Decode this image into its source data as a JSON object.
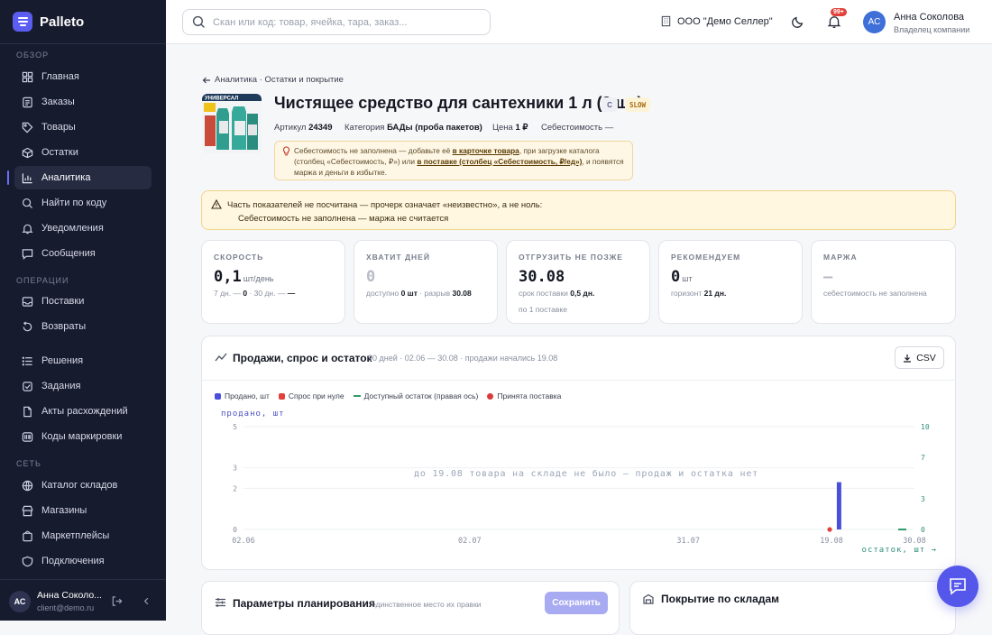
{
  "app": {
    "name": "Palleto"
  },
  "sidebar": {
    "section_overview": "ОБЗОР",
    "section_operations": "ОПЕРАЦИИ",
    "section_network": "СЕТЬ",
    "items": [
      {
        "label": "Главная",
        "icon": "dashboard-icon"
      },
      {
        "label": "Заказы",
        "icon": "orders-icon"
      },
      {
        "label": "Товары",
        "icon": "tag-icon"
      },
      {
        "label": "Остатки",
        "icon": "box-icon"
      },
      {
        "label": "Аналитика",
        "icon": "chart-icon",
        "active": true
      },
      {
        "label": "Найти по коду",
        "icon": "search-icon"
      },
      {
        "label": "Уведомления",
        "icon": "bell-icon"
      },
      {
        "label": "Сообщения",
        "icon": "message-icon"
      },
      {
        "label": "Поставки",
        "icon": "inbox-icon"
      },
      {
        "label": "Возвраты",
        "icon": "return-icon"
      },
      {
        "label": "Решения",
        "icon": "list-icon"
      },
      {
        "label": "Задания",
        "icon": "task-icon"
      },
      {
        "label": "Акты расхождений",
        "icon": "document-icon"
      },
      {
        "label": "Коды маркировки",
        "icon": "barcode-icon"
      },
      {
        "label": "Каталог складов",
        "icon": "warehouse-icon"
      },
      {
        "label": "Магазины",
        "icon": "shop-icon"
      },
      {
        "label": "Маркетплейсы",
        "icon": "cart-icon"
      },
      {
        "label": "Подключения",
        "icon": "plug-icon"
      }
    ],
    "footer": {
      "initials": "АС",
      "name": "Анна Соколо...",
      "email": "client@demo.ru"
    }
  },
  "topbar": {
    "search_placeholder": "Скан или код: товар, ячейка, тара, заказ...",
    "org": "ООО \"Демо Селлер\"",
    "notif_badge": "99+",
    "user_initials": "АС",
    "user_name": "Анна Соколова",
    "user_role": "Владелец компании"
  },
  "breadcrumb": {
    "text": "Аналитика · Остатки и покрытие"
  },
  "product": {
    "title": "Чистящее средство для сантехники 1 л (2 шт)",
    "class_tag": "C",
    "speed_tag": "SLOW",
    "article_label": "Артикул",
    "article": "24349",
    "category_label": "Категория",
    "category": "БАДы (проба пакетов)",
    "price_label": "Цена",
    "price": "1 ₽",
    "cost_label": "Себестоимость —",
    "image_text": "УНИВЕРСАЛ",
    "cost_note": {
      "text1": "Себестоимость не заполнена — добавьте её ",
      "link1": "в карточке товара",
      "text2": ", при загрузке каталога (столбец «Себестоимость, ₽») или ",
      "link2": "в поставке (столбец «Себестоимость, ₽/ед»)",
      "text3": ", и появятся маржа и деньги в избытке."
    }
  },
  "warning": {
    "line1": "Часть показателей не посчитана — прочерк означает «неизвестно», а не ноль:",
    "line2": "Себестоимость не заполнена — маржа не считается"
  },
  "kpis": [
    {
      "label": "СКОРОСТЬ",
      "value": "0,1",
      "unit": "шт/день",
      "sub_a": "7 дн. —",
      "sub_b": "0",
      "sub_c": "· 30 дн. —",
      "sub_d": "—"
    },
    {
      "label": "ХВАТИТ ДНЕЙ",
      "value": "0",
      "sub_a": "доступно",
      "sub_b": "0 шт",
      "sub_c": "· разрыв",
      "sub_d": "30.08"
    },
    {
      "label": "ОТГРУЗИТЬ НЕ ПОЗЖЕ",
      "value": "30.08",
      "sub_a": "срок поставки",
      "sub_b": "0,5 дн.",
      "sub2": "по 1 поставке"
    },
    {
      "label": "РЕКОМЕНДУЕМ",
      "value": "0",
      "unit": "шт",
      "sub_a": "горизонт",
      "sub_b": "21 дн."
    },
    {
      "label": "МАРЖА",
      "value": "—",
      "sub_a": "себестоимость не заполнена"
    }
  ],
  "chart_section": {
    "title": "Продажи, спрос и остаток",
    "subtitle": "90 дней · 02.06 — 30.08 · продажи начались 19.08",
    "csv_label": "CSV",
    "y_title": "продано, шт",
    "x_title": "остаток, шт →",
    "empty_note": "до 19.08 товара на складе не было — продаж и остатка нет"
  },
  "chart_data": {
    "type": "bar",
    "x_ticks": [
      "02.06",
      "02.07",
      "31.07",
      "19.08",
      "30.08"
    ],
    "y_left_ticks": [
      0,
      2,
      3,
      5
    ],
    "y_right_ticks": [
      0,
      3,
      7,
      10
    ],
    "ylim_left": [
      0,
      5
    ],
    "ylim_right": [
      0,
      10
    ],
    "series": [
      {
        "name": "Продано, шт",
        "color": "#4a4fd9",
        "points": [
          {
            "x": "20.08",
            "y": 2.3
          }
        ]
      },
      {
        "name": "Спрос при нуле",
        "color": "#e0413b",
        "points": [
          {
            "x": "19.08",
            "y": 0
          }
        ]
      },
      {
        "name": "Доступный остаток (правая ось)",
        "color": "#2f9a6b",
        "points": [
          {
            "x": "30.08",
            "y": 0
          }
        ]
      },
      {
        "name": "Принята поставка",
        "color": "#d93a3a",
        "points": [
          {
            "x": "19.08",
            "y": 0
          }
        ]
      }
    ]
  },
  "planning": {
    "title": "Параметры планирования",
    "subtitle": "единственное место их правки",
    "save_label": "Сохранить"
  },
  "coverage": {
    "title": "Покрытие по складам"
  }
}
